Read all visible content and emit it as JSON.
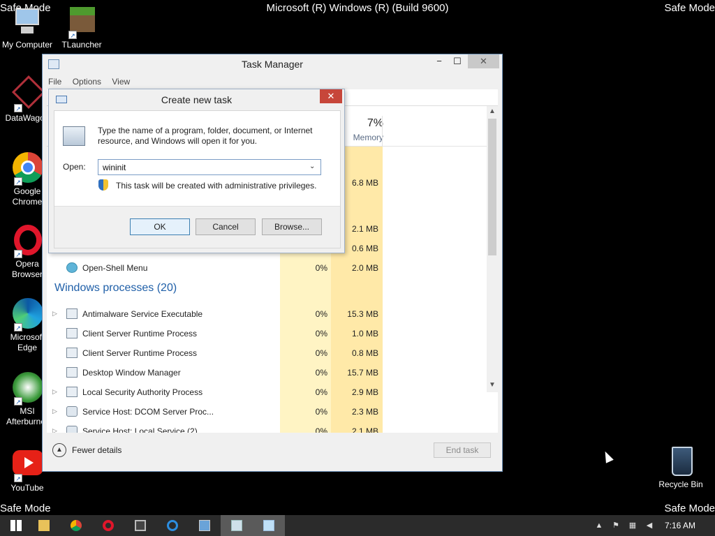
{
  "banner": {
    "build": "Microsoft (R) Windows (R) (Build 9600)",
    "safe_mode": "Safe Mode"
  },
  "desktop_icons": [
    {
      "label": "My Computer",
      "icon": "computer-icon"
    },
    {
      "label": "TLauncher",
      "icon": "minecraft-block-icon"
    },
    {
      "label": "DataWagon",
      "icon": "datawagon-icon"
    },
    {
      "label": "Google Chrome",
      "icon": "chrome-icon"
    },
    {
      "label": "Opera Browser",
      "icon": "opera-icon"
    },
    {
      "label": "Microsoft Edge",
      "icon": "edge-icon"
    },
    {
      "label": "MSI Afterburner",
      "icon": "msi-afterburner-icon"
    },
    {
      "label": "YouTube",
      "icon": "youtube-icon"
    },
    {
      "label": "Recycle Bin",
      "icon": "recycle-bin-icon"
    }
  ],
  "task_manager": {
    "title": "Task Manager",
    "menu": [
      "File",
      "Options",
      "View"
    ],
    "memory_pct": "7%",
    "memory_label": "Memory",
    "partial_rows": [
      {
        "name": "",
        "cpu": "",
        "mem": ""
      },
      {
        "name": "",
        "cpu": "",
        "mem": "6.8 MB"
      },
      {
        "name": "",
        "cpu": "",
        "mem": ""
      },
      {
        "name": "",
        "cpu": "",
        "mem": "2.1 MB"
      },
      {
        "name": "",
        "cpu": "",
        "mem": "0.6 MB"
      },
      {
        "name": "Open-Shell Menu",
        "cpu": "0%",
        "mem": "2.0 MB"
      }
    ],
    "group_title": "Windows processes (20)",
    "processes": [
      {
        "name": "Antimalware Service Executable",
        "cpu": "0%",
        "mem": "15.3 MB",
        "expandable": true
      },
      {
        "name": "Client Server Runtime Process",
        "cpu": "0%",
        "mem": "1.0 MB",
        "expandable": false
      },
      {
        "name": "Client Server Runtime Process",
        "cpu": "0%",
        "mem": "0.8 MB",
        "expandable": false
      },
      {
        "name": "Desktop Window Manager",
        "cpu": "0%",
        "mem": "15.7 MB",
        "expandable": false
      },
      {
        "name": "Local Security Authority Process",
        "cpu": "0%",
        "mem": "2.9 MB",
        "expandable": true
      },
      {
        "name": "Service Host: DCOM Server Proc...",
        "cpu": "0%",
        "mem": "2.3 MB",
        "expandable": true
      },
      {
        "name": "Service Host: Local Service (2)",
        "cpu": "0%",
        "mem": "2.1 MB",
        "expandable": true
      }
    ],
    "fewer_details": "Fewer details",
    "end_task": "End task"
  },
  "run_dialog": {
    "title": "Create new task",
    "description": "Type the name of a program, folder, document, or Internet resource, and Windows will open it for you.",
    "open_label": "Open:",
    "open_value": "wininit",
    "admin_note": "This task will be created with administrative privileges.",
    "ok": "OK",
    "cancel": "Cancel",
    "browse": "Browse..."
  },
  "taskbar": {
    "clock": "7:16 AM"
  }
}
